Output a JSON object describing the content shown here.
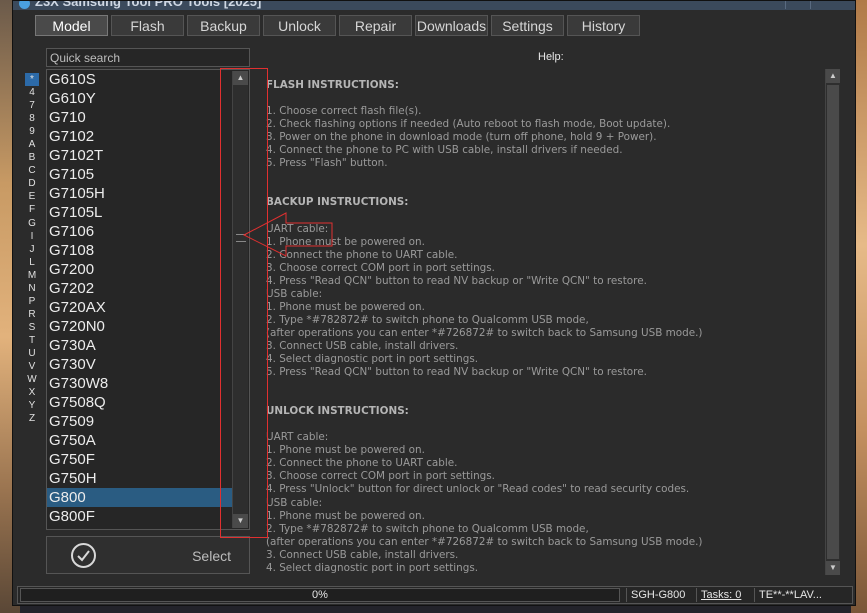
{
  "titlebar": {
    "title": "Z3X Samsung Tool PRO Tools [2025]"
  },
  "tabs": [
    "Model",
    "Flash",
    "Backup",
    "Unlock",
    "Repair",
    "Downloads",
    "Settings",
    "History"
  ],
  "active_tab": "Model",
  "sidebar": {
    "search_placeholder": "Quick search",
    "alpha_index": [
      "*",
      "4",
      "7",
      "8",
      "9",
      "A",
      "B",
      "C",
      "D",
      "E",
      "F",
      "G",
      "I",
      "J",
      "L",
      "M",
      "N",
      "P",
      "R",
      "S",
      "T",
      "U",
      "V",
      "W",
      "X",
      "Y",
      "Z"
    ],
    "models": [
      "G610S",
      "G610Y",
      "G710",
      "G7102",
      "G7102T",
      "G7105",
      "G7105H",
      "G7105L",
      "G7106",
      "G7108",
      "G7200",
      "G7202",
      "G720AX",
      "G720N0",
      "G730A",
      "G730V",
      "G730W8",
      "G7508Q",
      "G7509",
      "G750A",
      "G750F",
      "G750H",
      "G800",
      "G800F"
    ],
    "selected_model": "G800",
    "select_label": "Select"
  },
  "help": {
    "label": "Help:",
    "lines": [
      {
        "t": "FLASH INSTRUCTIONS:",
        "h": true
      },
      {
        "t": ""
      },
      {
        "t": "1. Choose correct flash file(s)."
      },
      {
        "t": "2. Check flashing options if needed (Auto reboot to flash mode, Boot update)."
      },
      {
        "t": "3. Power on the phone in download mode (turn off phone, hold 9 + Power)."
      },
      {
        "t": "4. Connect the phone to PC with USB cable, install drivers if needed."
      },
      {
        "t": "5. Press \"Flash\" button."
      },
      {
        "t": ""
      },
      {
        "t": ""
      },
      {
        "t": "BACKUP INSTRUCTIONS:",
        "h": true
      },
      {
        "t": ""
      },
      {
        "t": "  UART cable:"
      },
      {
        "t": "1. Phone must be powered on."
      },
      {
        "t": "2. Connect the phone to UART cable."
      },
      {
        "t": "3. Choose correct COM port in port settings."
      },
      {
        "t": "4. Press \"Read QCN\" button to read NV backup or \"Write QCN\" to restore."
      },
      {
        "t": "  USB cable:"
      },
      {
        "t": "1. Phone must be powered on."
      },
      {
        "t": "2. Type *#782872# to switch phone to Qualcomm USB mode,"
      },
      {
        "t": "   (after operations you can enter *#726872# to switch back to Samsung USB mode.)"
      },
      {
        "t": "3. Connect USB cable, install drivers."
      },
      {
        "t": "4. Select diagnostic port in port settings."
      },
      {
        "t": "5. Press \"Read QCN\" button to read NV backup or \"Write QCN\" to restore."
      },
      {
        "t": ""
      },
      {
        "t": ""
      },
      {
        "t": "UNLOCK INSTRUCTIONS:",
        "h": true
      },
      {
        "t": ""
      },
      {
        "t": "  UART cable:"
      },
      {
        "t": "1. Phone must be powered on."
      },
      {
        "t": "2. Connect the phone to UART cable."
      },
      {
        "t": "3. Choose correct COM port in port settings."
      },
      {
        "t": "4. Press \"Unlock\" button for direct unlock or \"Read codes\" to read security codes."
      },
      {
        "t": "  USB cable:"
      },
      {
        "t": "1. Phone must be powered on."
      },
      {
        "t": "2. Type *#782872# to switch phone to Qualcomm USB mode,"
      },
      {
        "t": "   (after operations you can enter *#726872# to switch back to Samsung USB mode.)"
      },
      {
        "t": "3. Connect USB cable, install drivers."
      },
      {
        "t": "4. Select diagnostic port in port settings."
      }
    ]
  },
  "status": {
    "progress_text": "0%",
    "progress_value": 0,
    "model": "SGH-G800",
    "tasks": "Tasks: 0",
    "user": "TE**-**LAV..."
  },
  "colors": {
    "accent": "#2a5c82",
    "annotation": "#e03030"
  }
}
